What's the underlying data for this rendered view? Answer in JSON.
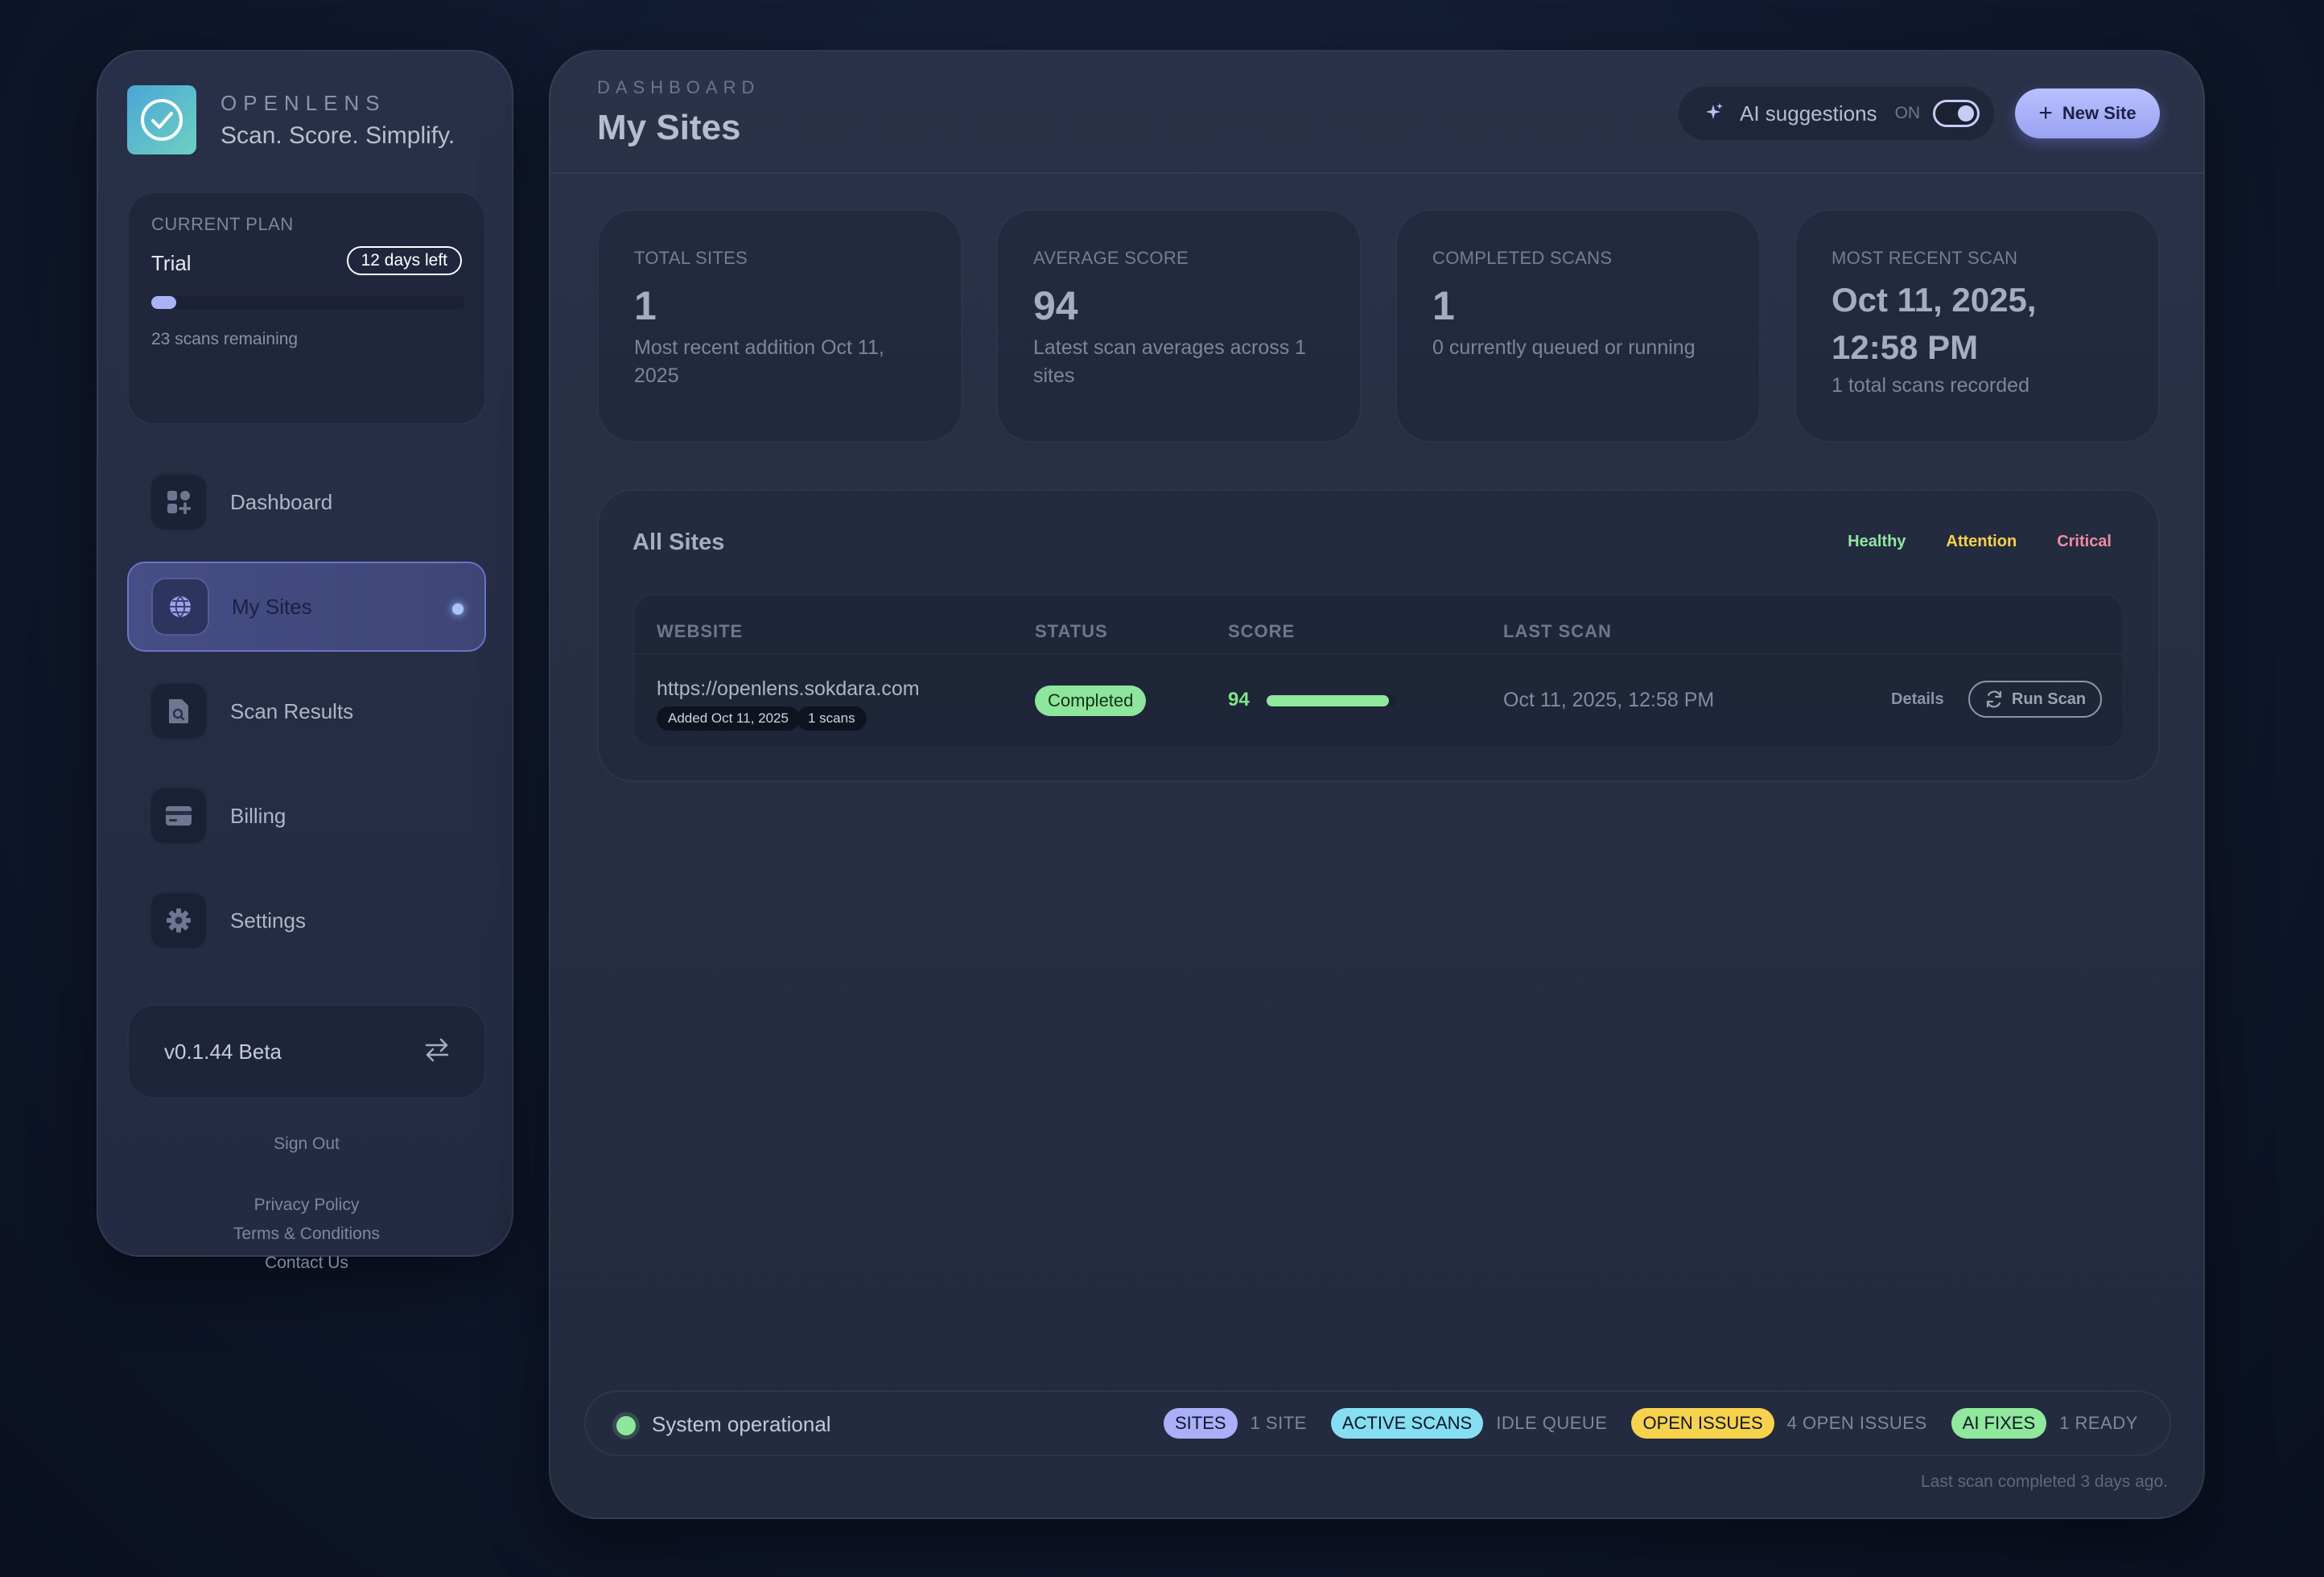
{
  "brand": {
    "name": "OPENLENS",
    "tagline": "Scan. Score. Simplify.",
    "logo_icon": "check-circle-icon"
  },
  "plan": {
    "label": "CURRENT PLAN",
    "name": "Trial",
    "days_left": "12 days left",
    "usage_fraction": 0.08,
    "remaining": "23 scans remaining"
  },
  "nav": {
    "items": [
      {
        "label": "Dashboard",
        "icon": "grid-icon",
        "active": false
      },
      {
        "label": "My Sites",
        "icon": "globe-icon",
        "active": true
      },
      {
        "label": "Scan Results",
        "icon": "document-search-icon",
        "active": false
      },
      {
        "label": "Billing",
        "icon": "credit-card-icon",
        "active": false
      },
      {
        "label": "Settings",
        "icon": "gear-icon",
        "active": false
      }
    ]
  },
  "version": {
    "label": "v0.1.44 Beta",
    "icon": "swap-arrows-icon"
  },
  "footer": {
    "sign_out": "Sign Out",
    "privacy": "Privacy Policy",
    "terms": "Terms & Conditions",
    "contact": "Contact Us"
  },
  "header": {
    "eyebrow": "DASHBOARD",
    "title": "My Sites",
    "ai_label": "AI suggestions",
    "ai_state": "ON",
    "ai_enabled": true,
    "new_site": "New Site"
  },
  "stats": [
    {
      "label": "TOTAL SITES",
      "value": "1",
      "sub": "Most recent addition Oct 11, 2025"
    },
    {
      "label": "AVERAGE SCORE",
      "value": "94",
      "sub": "Latest scan averages across 1 sites"
    },
    {
      "label": "COMPLETED SCANS",
      "value": "1",
      "sub": "0 currently queued or running"
    },
    {
      "label": "MOST RECENT SCAN",
      "value": "Oct 11, 2025, 12:58 PM",
      "sub": "1 total scans recorded"
    }
  ],
  "sites": {
    "title": "All Sites",
    "legend": [
      {
        "label": "Healthy",
        "color": "#8fe89b"
      },
      {
        "label": "Attention",
        "color": "#f5d04a"
      },
      {
        "label": "Critical",
        "color": "#f28ba2"
      }
    ],
    "columns": [
      "WEBSITE",
      "STATUS",
      "SCORE",
      "LAST SCAN"
    ],
    "rows": [
      {
        "url": "https://openlens.sokdara.com",
        "added": "Added Oct 11, 2025",
        "scans": "1 scans",
        "status": "Completed",
        "score": "94",
        "score_fraction": 0.94,
        "last_scan": "Oct 11, 2025, 12:58 PM",
        "details": "Details",
        "run_scan": "Run Scan"
      }
    ]
  },
  "status_bar": {
    "system": "System operational",
    "chips": [
      {
        "tag": "SITES",
        "desc": "1 SITE",
        "color": "#a9b0f8"
      },
      {
        "tag": "ACTIVE SCANS",
        "desc": "IDLE QUEUE",
        "color": "#86def2"
      },
      {
        "tag": "OPEN ISSUES",
        "desc": "4 OPEN ISSUES",
        "color": "#f7d24c"
      },
      {
        "tag": "AI FIXES",
        "desc": "1 READY",
        "color": "#8fe89b"
      }
    ],
    "footnote": "Last scan completed 3 days ago."
  },
  "colors": {
    "accent": "#a9b2f7",
    "success": "#8ee59c"
  }
}
